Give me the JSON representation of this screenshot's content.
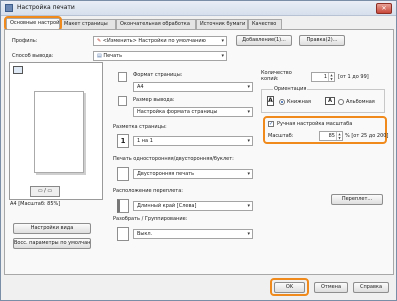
{
  "window": {
    "title": "Настройка печати",
    "close_glyph": "✕"
  },
  "tabs": [
    "Основные настройки",
    "Макет страницы",
    "Окончательная обработка",
    "Источник бумаги",
    "Качество"
  ],
  "profile": {
    "label": "Профиль:",
    "value": "<Изменить> Настройки по умолчанию",
    "add_button": "Добавление(1)...",
    "edit_button": "Правка(2)..."
  },
  "output": {
    "label": "Способ вывода:",
    "value": "Печать"
  },
  "preview": {
    "caption": "A4 [Масштаб: 85%]",
    "view_button": "Настройки вида",
    "restore_button": "Восс. параметры по умолчанию"
  },
  "page_format": {
    "label": "Формат страницы:",
    "value": "A4"
  },
  "output_size": {
    "label": "Размер вывода:",
    "value": "Настройка формата страницы"
  },
  "layout": {
    "label": "Разметка страницы:",
    "value": "1 на 1",
    "icon_text": "1"
  },
  "copies": {
    "label": "Количество копий:",
    "value": "1",
    "range": "[от 1 до 99]"
  },
  "orientation": {
    "label": "Ориентация",
    "portrait": "Книжная",
    "landscape": "Альбомная",
    "portrait_icon": "A",
    "landscape_icon": "A"
  },
  "scaling": {
    "checkbox_label": "Ручная настройка масштаба",
    "scale_label": "Масштаб:",
    "scale_value": "85",
    "range": "% [от 25 до 200]"
  },
  "duplex": {
    "label": "Печать односторонняя/двусторонняя/буклет:",
    "value": "Двусторонняя печать"
  },
  "binding": {
    "label": "Расположение переплета:",
    "value": "Длинный край [Слева]",
    "button": "Переплет..."
  },
  "collate": {
    "label": "Разобрать / Группирование:",
    "value": "Выкл."
  },
  "footer": {
    "ok": "OK",
    "cancel": "Отмена",
    "help": "Справка"
  },
  "colors": {
    "highlight": "#f08a1c"
  }
}
